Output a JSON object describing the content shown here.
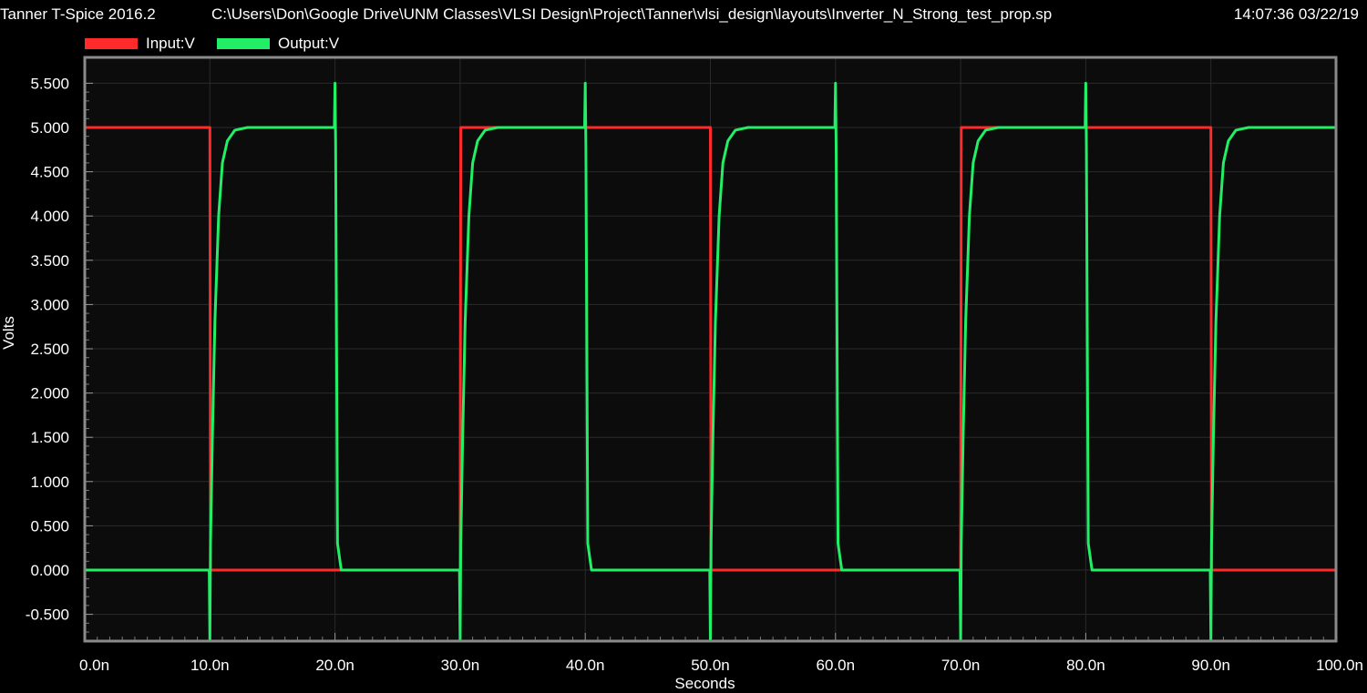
{
  "header": {
    "app_title": "Tanner T-Spice 2016.2",
    "file_path": "C:\\Users\\Don\\Google Drive\\UNM Classes\\VLSI Design\\Project\\Tanner\\vlsi_design\\layouts\\Inverter_N_Strong_test_prop.sp",
    "timestamp": "14:07:36 03/22/19"
  },
  "colors": {
    "background": "#000000",
    "plot_background": "#0c0c0c",
    "grid": "#2a2a2a",
    "frame": "#8a8a8a",
    "input": "#ff2a2a",
    "output": "#22ee66"
  },
  "chart_data": {
    "type": "line",
    "title": "",
    "xlabel": "Seconds",
    "ylabel": "Volts",
    "xlim": [
      0,
      100
    ],
    "ylim": [
      -0.8,
      5.5
    ],
    "x_unit": "ns",
    "grid": true,
    "legend_position": "top-left",
    "x_ticks": [
      "0.0n",
      "10.0n",
      "20.0n",
      "30.0n",
      "40.0n",
      "50.0n",
      "60.0n",
      "70.0n",
      "80.0n",
      "90.0n",
      "100.0n"
    ],
    "y_ticks": [
      "5.500",
      "5.000",
      "4.500",
      "4.000",
      "3.500",
      "3.000",
      "2.500",
      "2.000",
      "1.500",
      "1.000",
      "0.500",
      "0.000",
      "-0.500"
    ],
    "series": [
      {
        "name": "Input:V",
        "color": "#ff2a2a",
        "x": [
          0,
          10,
          10.05,
          30,
          30.05,
          50,
          50.05,
          70,
          70.05,
          90,
          90.05,
          100
        ],
        "y": [
          5,
          5,
          0,
          0,
          5,
          5,
          0,
          0,
          5,
          5,
          0,
          0
        ]
      },
      {
        "name": "Output:V",
        "color": "#22ee66",
        "x": [
          0,
          9.95,
          10,
          10.05,
          10.2,
          10.4,
          10.7,
          11.0,
          11.4,
          12.0,
          13.0,
          19.95,
          20,
          20.05,
          20.2,
          20.5,
          29.95,
          30,
          30.05,
          30.2,
          30.4,
          30.7,
          31.0,
          31.4,
          32.0,
          33.0,
          39.95,
          40,
          40.05,
          40.2,
          40.5,
          49.95,
          50,
          50.05,
          50.2,
          50.4,
          50.7,
          51.0,
          51.4,
          52.0,
          53.0,
          59.95,
          60,
          60.05,
          60.2,
          60.5,
          69.95,
          70,
          70.05,
          70.2,
          70.4,
          70.7,
          71.0,
          71.4,
          72.0,
          73.0,
          79.95,
          80,
          80.05,
          80.2,
          80.5,
          89.95,
          90,
          90.05,
          90.2,
          90.4,
          90.7,
          91.0,
          91.4,
          92.0,
          93.0,
          100
        ],
        "y": [
          0,
          0,
          -0.8,
          0.3,
          1.5,
          2.8,
          4.0,
          4.6,
          4.85,
          4.97,
          5,
          5,
          5.5,
          4.8,
          0.3,
          0,
          0,
          -0.8,
          0.3,
          1.5,
          2.8,
          4.0,
          4.6,
          4.85,
          4.97,
          5,
          5,
          5.5,
          4.8,
          0.3,
          0,
          0,
          -0.8,
          0.3,
          1.5,
          2.8,
          4.0,
          4.6,
          4.85,
          4.97,
          5,
          5,
          5.5,
          4.8,
          0.3,
          0,
          0,
          -0.8,
          0.3,
          1.5,
          2.8,
          4.0,
          4.6,
          4.85,
          4.97,
          5,
          5,
          5.5,
          4.8,
          0.3,
          0,
          0,
          -0.8,
          0.3,
          1.5,
          2.8,
          4.0,
          4.6,
          4.85,
          4.97,
          5,
          5
        ]
      }
    ]
  }
}
